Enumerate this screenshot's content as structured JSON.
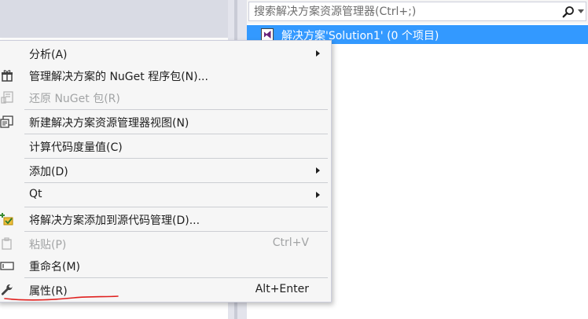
{
  "solution_explorer": {
    "search_placeholder": "搜索解决方案资源管理器(Ctrl+;)",
    "selected_item": "解决方案'Solution1' (0 个项目)"
  },
  "context_menu": {
    "items": [
      {
        "label": "分析(A)",
        "submenu": true,
        "enabled": true,
        "icon": ""
      },
      {
        "label": "管理解决方案的 NuGet 程序包(N)...",
        "submenu": false,
        "enabled": true,
        "icon": "nuget-package-icon"
      },
      {
        "label": "还原 NuGet 包(R)",
        "submenu": false,
        "enabled": false,
        "icon": "restore-packages-icon"
      },
      {
        "label": "新建解决方案资源管理器视图(N)",
        "submenu": false,
        "enabled": true,
        "icon": "new-view-icon"
      },
      {
        "label": "计算代码度量值(C)",
        "submenu": false,
        "enabled": true,
        "icon": ""
      },
      {
        "label": "添加(D)",
        "submenu": true,
        "enabled": true,
        "icon": ""
      },
      {
        "label": "Qt",
        "submenu": true,
        "enabled": true,
        "icon": ""
      },
      {
        "label": "将解决方案添加到源代码管理(D)...",
        "submenu": false,
        "enabled": true,
        "icon": "add-source-control-icon"
      },
      {
        "label": "粘贴(P)",
        "shortcut": "Ctrl+V",
        "submenu": false,
        "enabled": false,
        "icon": "paste-icon"
      },
      {
        "label": "重命名(M)",
        "submenu": false,
        "enabled": true,
        "icon": "rename-icon"
      },
      {
        "label": "属性(R)",
        "shortcut": "Alt+Enter",
        "submenu": false,
        "enabled": true,
        "icon": "wrench-icon"
      }
    ]
  },
  "colors": {
    "selection": "#3399ff",
    "annotation_underline": "#e0201e",
    "disabled_text": "#a2a4a5"
  }
}
